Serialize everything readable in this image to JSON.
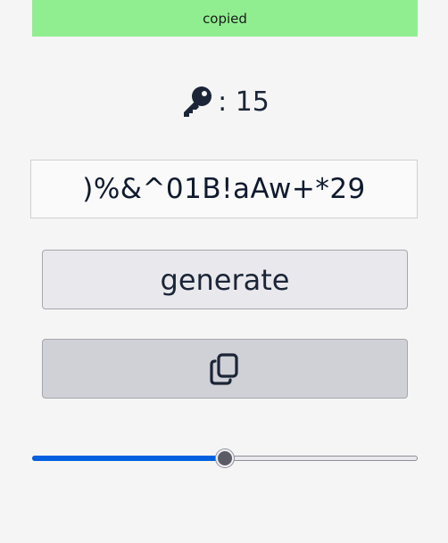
{
  "toast": {
    "message": "copied",
    "color": "#90ee90"
  },
  "length_display": {
    "icon": "key-icon",
    "text": ": 15"
  },
  "password": {
    "value": ")%&^01B!aAw+*29"
  },
  "generate_button": {
    "label": "generate"
  },
  "copy_button": {
    "icon": "copy-icon"
  },
  "length_slider": {
    "value_fraction": 0.5,
    "accent": "#0060df"
  }
}
